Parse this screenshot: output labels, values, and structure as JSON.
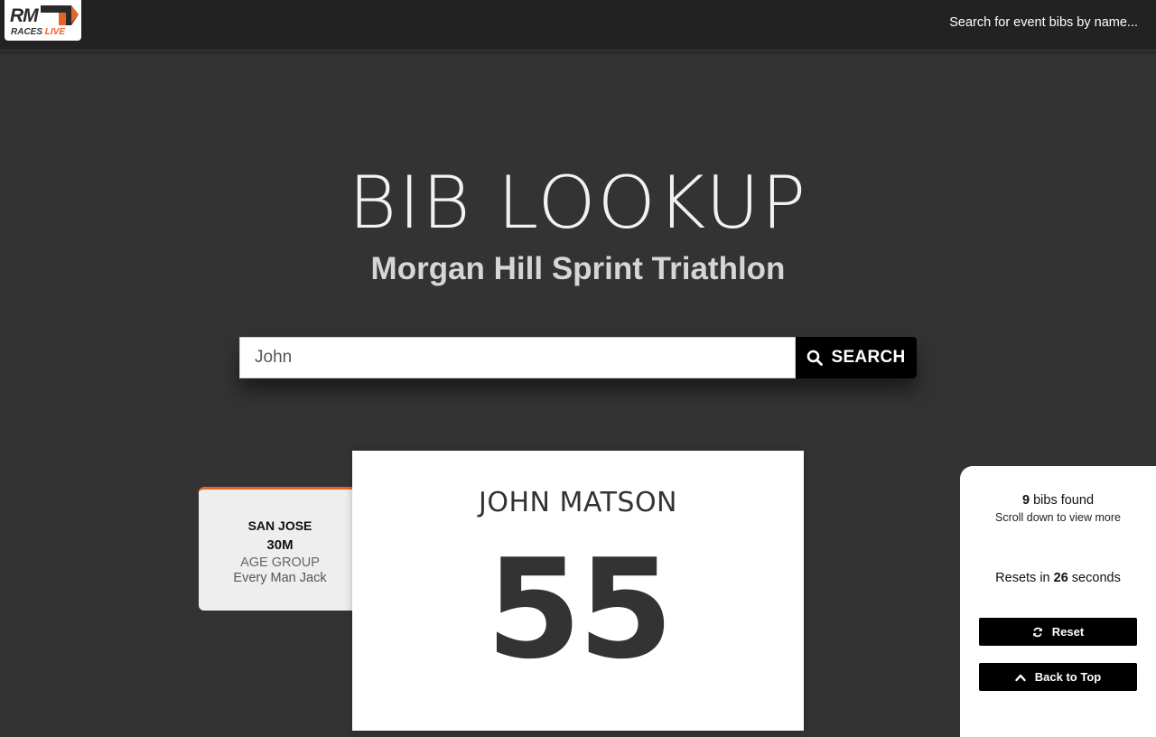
{
  "header": {
    "logo_main": "RM",
    "logo_races": "RACES",
    "logo_live": "LIVE",
    "search_link": "Search for event bibs by name..."
  },
  "hero": {
    "title": "BIB LOOKUP",
    "event_name": "Morgan Hill Sprint Triathlon"
  },
  "search": {
    "value": "John",
    "button_label": "SEARCH",
    "button_icon": "search-icon"
  },
  "side_card": {
    "city": "SAN JOSE",
    "age_group": "30M",
    "label": "AGE GROUP",
    "team": "Every Man Jack"
  },
  "result": {
    "name": "JOHN MATSON",
    "bib": "55"
  },
  "panel": {
    "found_count": "9",
    "found_text": " bibs found",
    "scroll_hint": "Scroll down to view more",
    "resets_prefix": "Resets in ",
    "resets_seconds": "26",
    "resets_suffix": " seconds",
    "reset_label": "Reset",
    "reset_icon": "refresh-icon",
    "top_label": "Back to Top",
    "top_icon": "chevron-up-icon"
  },
  "colors": {
    "background": "#333333",
    "topbar": "#222222",
    "accent": "#e8622c",
    "button": "#000000"
  }
}
